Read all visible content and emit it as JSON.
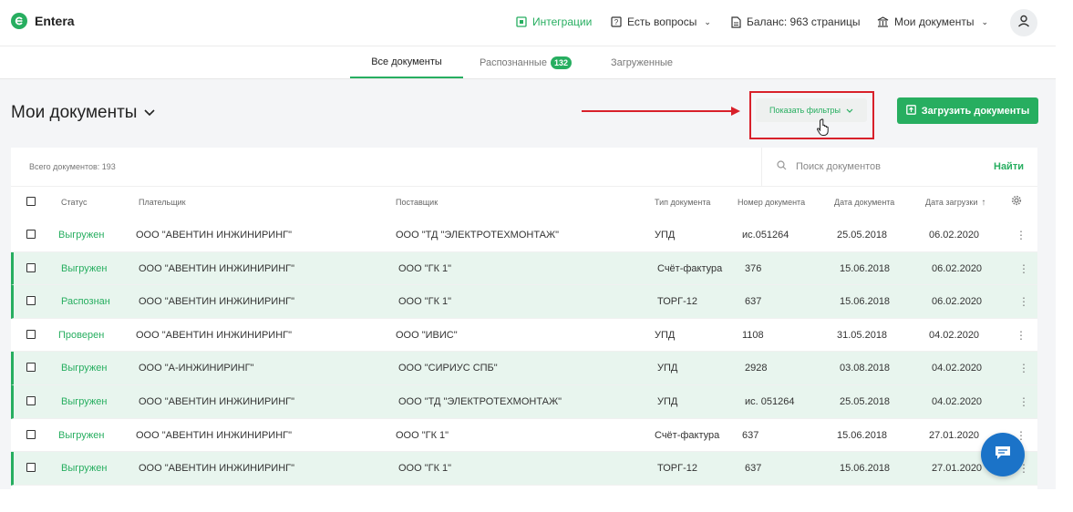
{
  "header": {
    "brand": "Entera",
    "integrations": "Интеграции",
    "questions": "Есть вопросы",
    "balance": "Баланс: 963 страницы",
    "my_documents": "Мои документы"
  },
  "tabs": [
    {
      "label": "Все документы",
      "active": true
    },
    {
      "label": "Распознанные",
      "badge": "132"
    },
    {
      "label": "Загруженные"
    }
  ],
  "page": {
    "title": "Мои документы",
    "show_filters": "Показать фильтры",
    "upload_button": "Загрузить документы"
  },
  "toolbar": {
    "total": "Всего документов: 193",
    "search_placeholder": "Поиск документов",
    "find": "Найти"
  },
  "columns": {
    "status": "Статус",
    "payer": "Плательщик",
    "supplier": "Поставщик",
    "doc_type": "Тип документа",
    "doc_number": "Номер документа",
    "doc_date": "Дата документа",
    "upload_date": "Дата загрузки"
  },
  "rows": [
    {
      "status": "Выгружен",
      "payer": "ООО \"АВЕНТИН ИНЖИНИРИНГ\"",
      "supplier": "ООО \"ТД \"ЭЛЕКТРОТЕХМОНТАЖ\"",
      "type": "УПД",
      "number": "ис.051264",
      "date": "25.05.2018",
      "uploaded": "06.02.2020",
      "selected": false
    },
    {
      "status": "Выгружен",
      "payer": "ООО \"АВЕНТИН ИНЖИНИРИНГ\"",
      "supplier": "ООО \"ГК 1\"",
      "type": "Счёт-фактура",
      "number": "376",
      "date": "15.06.2018",
      "uploaded": "06.02.2020",
      "selected": true
    },
    {
      "status": "Распознан",
      "payer": "ООО \"АВЕНТИН ИНЖИНИРИНГ\"",
      "supplier": "ООО \"ГК 1\"",
      "type": "ТОРГ-12",
      "number": "637",
      "date": "15.06.2018",
      "uploaded": "06.02.2020",
      "selected": true
    },
    {
      "status": "Проверен",
      "payer": "ООО \"АВЕНТИН ИНЖИНИРИНГ\"",
      "supplier": "ООО \"ИВИС\"",
      "type": "УПД",
      "number": "1108",
      "date": "31.05.2018",
      "uploaded": "04.02.2020",
      "selected": false
    },
    {
      "status": "Выгружен",
      "payer": "ООО \"А-ИНЖИНИРИНГ\"",
      "supplier": "ООО \"СИРИУС СПБ\"",
      "type": "УПД",
      "number": "2928",
      "date": "03.08.2018",
      "uploaded": "04.02.2020",
      "selected": true
    },
    {
      "status": "Выгружен",
      "payer": "ООО \"АВЕНТИН ИНЖИНИРИНГ\"",
      "supplier": "ООО \"ТД \"ЭЛЕКТРОТЕХМОНТАЖ\"",
      "type": "УПД",
      "number": "ис. 051264",
      "date": "25.05.2018",
      "uploaded": "04.02.2020",
      "selected": true
    },
    {
      "status": "Выгружен",
      "payer": "ООО \"АВЕНТИН ИНЖИНИРИНГ\"",
      "supplier": "ООО \"ГК 1\"",
      "type": "Счёт-фактура",
      "number": "637",
      "date": "15.06.2018",
      "uploaded": "27.01.2020",
      "selected": false
    },
    {
      "status": "Выгружен",
      "payer": "ООО \"АВЕНТИН ИНЖИНИРИНГ\"",
      "supplier": "ООО \"ГК 1\"",
      "type": "ТОРГ-12",
      "number": "637",
      "date": "15.06.2018",
      "uploaded": "27.01.2020",
      "selected": true
    }
  ],
  "colors": {
    "accent": "#27ae60",
    "annotation": "#d8202a",
    "chat": "#1b73c8"
  }
}
